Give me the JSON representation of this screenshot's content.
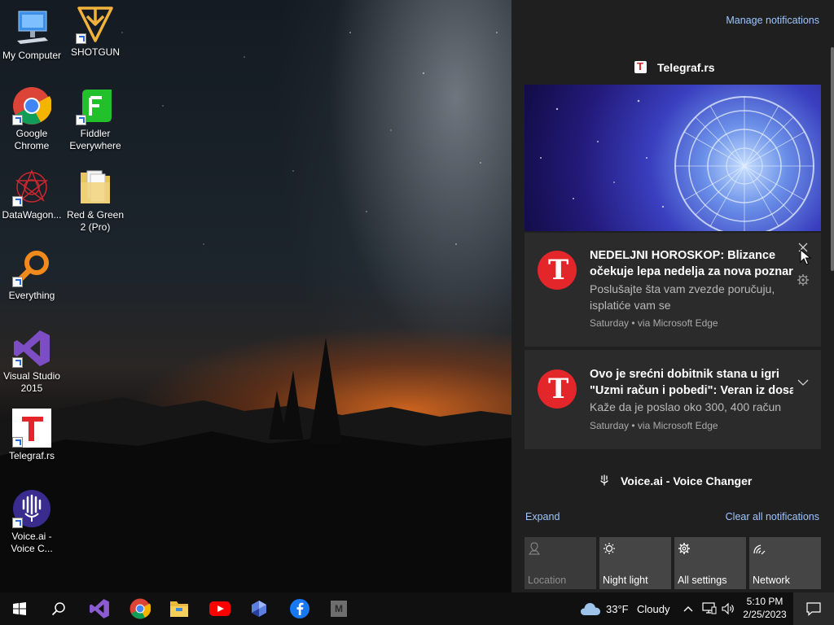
{
  "desktop": {
    "icons": [
      {
        "label": "My Computer"
      },
      {
        "label": "SHOTGUN"
      },
      {
        "label": "Google Chrome"
      },
      {
        "label": "Fiddler Everywhere"
      },
      {
        "label": "DataWagon..."
      },
      {
        "label": "Red & Green 2 (Pro)"
      },
      {
        "label": "Everything"
      },
      {
        "label": "Visual Studio 2015"
      },
      {
        "label": "Telegraf.rs"
      },
      {
        "label": "Voice.ai - Voice C..."
      }
    ]
  },
  "action_center": {
    "manage_link": "Manage notifications",
    "groups": [
      {
        "app": "Telegraf.rs",
        "notifications": [
          {
            "title": "NEDELJNI HOROSKOP: Blizance očekuje lepa nedelja za nova poznar",
            "title_line1": "NEDELJNI HOROSKOP: Blizance",
            "title_line2": "očekuje lepa nedelja za nova poznar",
            "body": "Poslušajte šta vam zvezde poručuju, isplatiće vam se",
            "meta": "Saturday • via Microsoft Edge"
          },
          {
            "title_line1": "Ovo je srećni dobitnik stana u igri",
            "title_line2": "\"Uzmi račun i pobedi\": Veran iz dosa",
            "body": "Kaže da je poslao oko 300, 400 račun",
            "meta": "Saturday • via Microsoft Edge"
          }
        ]
      },
      {
        "app": "Voice.ai - Voice Changer"
      }
    ],
    "expand_link": "Expand",
    "clear_link": "Clear all notifications",
    "quick_actions": [
      {
        "label": "Location",
        "icon": "location-icon",
        "enabled": false
      },
      {
        "label": "Night light",
        "icon": "night-light-icon",
        "enabled": true
      },
      {
        "label": "All settings",
        "icon": "gear-icon",
        "enabled": true
      },
      {
        "label": "Network",
        "icon": "network-icon",
        "enabled": true
      }
    ]
  },
  "taskbar": {
    "weather_temp": "33°F",
    "weather_text": "Cloudy",
    "time": "5:10 PM",
    "date": "2/25/2023",
    "pinned": [
      "start-icon",
      "search-icon",
      "visual-studio-icon",
      "chrome-icon",
      "file-explorer-icon",
      "youtube-icon",
      "app-icon",
      "facebook-icon",
      "m-app-icon"
    ],
    "m_app_letter": "M"
  },
  "colors": {
    "accent_link": "#9ec5ff",
    "panel_bg": "#1f1f1f",
    "card_bg": "#2b2b2b",
    "telegraf_red": "#e3262a"
  }
}
